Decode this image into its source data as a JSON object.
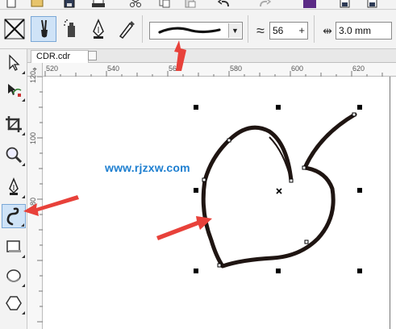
{
  "property_bar": {
    "smoothing_value": "56",
    "smoothing_plus": "+",
    "stroke_width_value": "3.0 mm"
  },
  "document_tab": {
    "label": "CDR.cdr"
  },
  "ruler": {
    "h_labels": [
      "520",
      "540",
      "560",
      "580",
      "600",
      "620"
    ],
    "v_labels": [
      "120",
      "100",
      "80"
    ]
  },
  "watermark": {
    "text": "www.rjzxw.com"
  },
  "colors": {
    "accent_arrow": "#e8413a",
    "watermark": "#1e7fd0",
    "stroke": "#1f1512"
  },
  "icons": {
    "toolbar": [
      "new-icon",
      "save-icon",
      "print-icon",
      "cut-icon",
      "copy-icon",
      "paste-icon",
      "undo-icon",
      "redo-icon",
      "app-launcher-icon",
      "import-icon",
      "export-icon"
    ],
    "property_bar": [
      "preset-brush-icon",
      "brush-icon",
      "sprayer-icon",
      "calligraphic-pen-icon",
      "pressure-pen-icon",
      "smoothing-icon",
      "stroke-width-icon"
    ],
    "toolbox": [
      "pick-tool-icon",
      "shape-tool-icon",
      "crop-tool-icon",
      "zoom-tool-icon",
      "pen-tool-icon",
      "artistic-media-tool-icon",
      "rectangle-tool-icon",
      "ellipse-tool-icon",
      "polygon-tool-icon"
    ]
  }
}
